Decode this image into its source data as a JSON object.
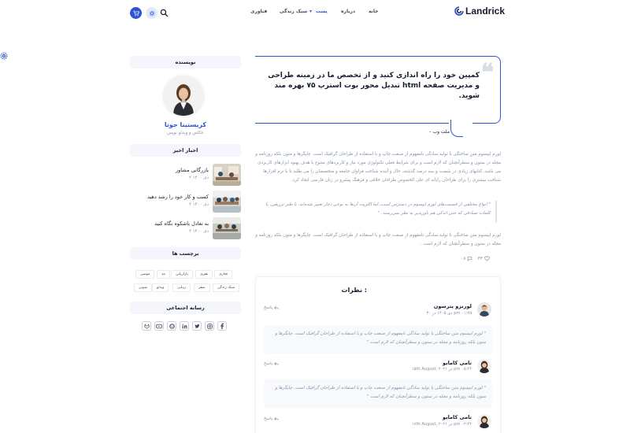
{
  "brand": {
    "name": "Landrick",
    "accent": "#2f55d4"
  },
  "nav": {
    "home": "خانه",
    "about": "درباره",
    "post": "پست",
    "lifestyle": "سبک زندگی",
    "tech": "فناوری"
  },
  "sidebar": {
    "author_header": "نویسنده",
    "author_name": "کریستینا جوتا",
    "author_role": "عکاس و ویدئو نویس",
    "news_header": "اخبار اخیر",
    "news": [
      {
        "title": "بازرگانی مشاور",
        "date": "۲ دی ۱۴۰۰"
      },
      {
        "title": "کسب و کار خود را رشد دهید",
        "date": "۲ دی ۱۴۰۰"
      },
      {
        "title": "به تعادل باشکوه نگاه کنید",
        "date": "۲ دی ۱۴۰۰"
      }
    ],
    "tags_header": "برچسب ها",
    "tags_row1": [
      "تجاری",
      "هنری",
      "بازاریابی",
      "مد",
      "موسی"
    ],
    "tags_row2": [
      "سبک زندگی",
      "سفر",
      "زیبایی",
      "ویدئو",
      "صوتی"
    ],
    "social_header": "رسانه اجتماعی",
    "social_icons": [
      "facebook-icon",
      "instagram-icon",
      "twitter-icon",
      "linkedin-icon",
      "github-icon",
      "youtube-icon",
      "gitlab-icon"
    ]
  },
  "quote": {
    "text": "کمپین خود را راه اندازی کنید و از تخصص ما در زمینه طراحی و مدیریت صفحه html تبدیل محور بوت استرپ ۷۵ بهره مند شوید.",
    "source": "- ملت وب"
  },
  "article": {
    "para1": "لورم ایپسوم متن ساختگی با تولید سادگی نامفهوم از صنعت چاپ و با استفاده از طراحان گرافیک است. چاپگرها و متون بلکه روزنامه و مجله در ستون و سطرآنچنان که لازم است و برای شرایط فعلی تکنولوژی مورد نیاز و کاربردهای متنوع با هدف بهبود ابزارهای کاربردی می باشد. کتابهای زیادی در شصت و سه درصد گذشته، حال و آینده شناخت فراوان جامعه و متخصصان را می طلبد تا با نرم افزارها شناخت بیشتری را برای طراحان رایانه ای علی الخصوص طراحان خلاقی و فرهنگ پیشرو در زبان فارسی ایجاد کرد.",
    "blockquote": "\" انواع مختلفی از قسمت‌های لورم ایپسوم در دسترس است، اما اکثریت آن‌ها به نوعی دچار تغییر شده‌اند، با طنز تزریقی، یا کلمات تصادفی که حتی اندکی هم باورپذیر به نظر نمی‌رسند. \"",
    "para2": "لورم ایپسوم متن ساختگی با تولید سادگی نامفهوم از صنعت چاپ و با استفاده از طراحان گرافیک است. چاپگرها و متون بلکه روزنامه و مجله در ستون و سطرآنچنان که لازم است .",
    "likes": "۳۳",
    "comments_count": "۰۸"
  },
  "comments": {
    "title": "نظرات :",
    "reply_label": "پاسخ",
    "items": [
      {
        "name": "لورنزو پترسون",
        "date": "۳۰ دی ۱۴۰۵ در pm ۰۱:۲۵",
        "text": "\" لورم ایپسوم متن ساختگی با تولید سادگی نامفهوم از صنعت چاپ و با استفاده از طراحان گرافیک است. چاپگرها و متون بلکه روزنامه و مجله در ستون و سطرآنچنان که لازم است \""
      },
      {
        "name": "تامی کامایو",
        "date": "۱۵th August, ۲۰۲۱ در pm ۰۵:۴۴",
        "text": "\" لورم ایپسوم متن ساختگی با تولید سادگی نامفهوم از صنعت چاپ و با استفاده از طراحان گرافیک است. چاپگرها و متون بلکه روزنامه و مجله در ستون و سطرآنچنان که لازم است \""
      },
      {
        "name": "تامی کامایو",
        "date": "۱۷th August, ۲۰۲۱ در pm ۰۳:۴۴",
        "text": ""
      }
    ]
  }
}
